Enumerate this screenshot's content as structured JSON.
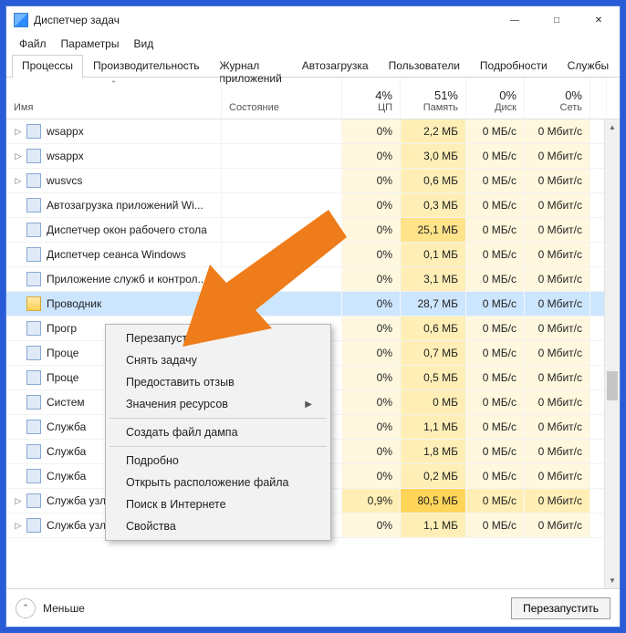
{
  "window": {
    "title": "Диспетчер задач"
  },
  "menu": {
    "file": "Файл",
    "options": "Параметры",
    "view": "Вид"
  },
  "tabs": [
    "Процессы",
    "Производительность",
    "Журнал приложений",
    "Автозагрузка",
    "Пользователи",
    "Подробности",
    "Службы"
  ],
  "columns": {
    "name": "Имя",
    "state": "Состояние",
    "cpu": {
      "pct": "4%",
      "label": "ЦП"
    },
    "mem": {
      "pct": "51%",
      "label": "Память"
    },
    "disk": {
      "pct": "0%",
      "label": "Диск"
    },
    "net": {
      "pct": "0%",
      "label": "Сеть"
    }
  },
  "rows": [
    {
      "exp": true,
      "icon": "gear",
      "name": "wsappx",
      "cpu": "0%",
      "mem": "2,2 МБ",
      "disk": "0 МБ/с",
      "net": "0 Мбит/с",
      "cpu_t": 0,
      "mem_t": 1
    },
    {
      "exp": true,
      "icon": "gear",
      "name": "wsappx",
      "cpu": "0%",
      "mem": "3,0 МБ",
      "disk": "0 МБ/с",
      "net": "0 Мбит/с",
      "cpu_t": 0,
      "mem_t": 1
    },
    {
      "exp": true,
      "icon": "gear",
      "name": "wusvcs",
      "cpu": "0%",
      "mem": "0,6 МБ",
      "disk": "0 МБ/с",
      "net": "0 Мбит/с",
      "cpu_t": 0,
      "mem_t": 1
    },
    {
      "exp": false,
      "icon": "app",
      "name": "Автозагрузка приложений Wi...",
      "cpu": "0%",
      "mem": "0,3 МБ",
      "disk": "0 МБ/с",
      "net": "0 Мбит/с",
      "cpu_t": 0,
      "mem_t": 1
    },
    {
      "exp": false,
      "icon": "app",
      "name": "Диспетчер окон рабочего стола",
      "cpu": "0%",
      "mem": "25,1 МБ",
      "disk": "0 МБ/с",
      "net": "0 Мбит/с",
      "cpu_t": 0,
      "mem_t": 2
    },
    {
      "exp": false,
      "icon": "app",
      "name": "Диспетчер сеанса  Windows",
      "cpu": "0%",
      "mem": "0,1 МБ",
      "disk": "0 МБ/с",
      "net": "0 Мбит/с",
      "cpu_t": 0,
      "mem_t": 1
    },
    {
      "exp": false,
      "icon": "app",
      "name": "Приложение служб и контрол...",
      "cpu": "0%",
      "mem": "3,1 МБ",
      "disk": "0 МБ/с",
      "net": "0 Мбит/с",
      "cpu_t": 0,
      "mem_t": 1
    },
    {
      "exp": false,
      "icon": "folder",
      "name": "Проводник",
      "cpu": "0%",
      "mem": "28,7 МБ",
      "disk": "0 МБ/с",
      "net": "0 Мбит/с",
      "selected": true,
      "cpu_t": 0,
      "mem_t": 2
    },
    {
      "exp": false,
      "icon": "app",
      "name": "Прогр",
      "cpu": "0%",
      "mem": "0,6 МБ",
      "disk": "0 МБ/с",
      "net": "0 Мбит/с",
      "cpu_t": 0,
      "mem_t": 1
    },
    {
      "exp": false,
      "icon": "app",
      "name": "Проце",
      "cpu": "0%",
      "mem": "0,7 МБ",
      "disk": "0 МБ/с",
      "net": "0 Мбит/с",
      "cpu_t": 0,
      "mem_t": 1
    },
    {
      "exp": false,
      "icon": "app",
      "name": "Проце",
      "cpu": "0%",
      "mem": "0,5 МБ",
      "disk": "0 МБ/с",
      "net": "0 Мбит/с",
      "cpu_t": 0,
      "mem_t": 1
    },
    {
      "exp": false,
      "icon": "app",
      "name": "Систем",
      "cpu": "0%",
      "mem": "0 МБ",
      "disk": "0 МБ/с",
      "net": "0 Мбит/с",
      "cpu_t": 0,
      "mem_t": 1
    },
    {
      "exp": false,
      "icon": "gear",
      "name": "Служба",
      "cpu": "0%",
      "mem": "1,1 МБ",
      "disk": "0 МБ/с",
      "net": "0 Мбит/с",
      "cpu_t": 0,
      "mem_t": 1
    },
    {
      "exp": false,
      "icon": "gear",
      "name": "Служба",
      "cpu": "0%",
      "mem": "1,8 МБ",
      "disk": "0 МБ/с",
      "net": "0 Мбит/с",
      "cpu_t": 0,
      "mem_t": 1
    },
    {
      "exp": false,
      "icon": "gear",
      "name": "Служба",
      "cpu": "0%",
      "mem": "0,2 МБ",
      "disk": "0 МБ/с",
      "net": "0 Мбит/с",
      "cpu_t": 0,
      "mem_t": 1
    },
    {
      "exp": true,
      "icon": "gear",
      "name": "Служба узла: SysMain",
      "cpu": "0,9%",
      "mem": "80,5 МБ",
      "disk": "0 МБ/с",
      "net": "0 Мбит/с",
      "cpu_t": 1,
      "mem_t": 3
    },
    {
      "exp": true,
      "icon": "gear",
      "name": "Служба узла: Автоматическая ...",
      "cpu": "0%",
      "mem": "1,1 МБ",
      "disk": "0 МБ/с",
      "net": "0 Мбит/с",
      "cpu_t": 0,
      "mem_t": 1
    }
  ],
  "context_menu": {
    "items": [
      "Перезапустить",
      "Снять задачу",
      "Предоставить отзыв",
      "Значения ресурсов",
      "-",
      "Создать файл дампа",
      "-",
      "Подробно",
      "Открыть расположение файла",
      "Поиск в Интернете",
      "Свойства"
    ],
    "submenu_index": 3
  },
  "footer": {
    "less": "Меньше",
    "action": "Перезапустить"
  }
}
